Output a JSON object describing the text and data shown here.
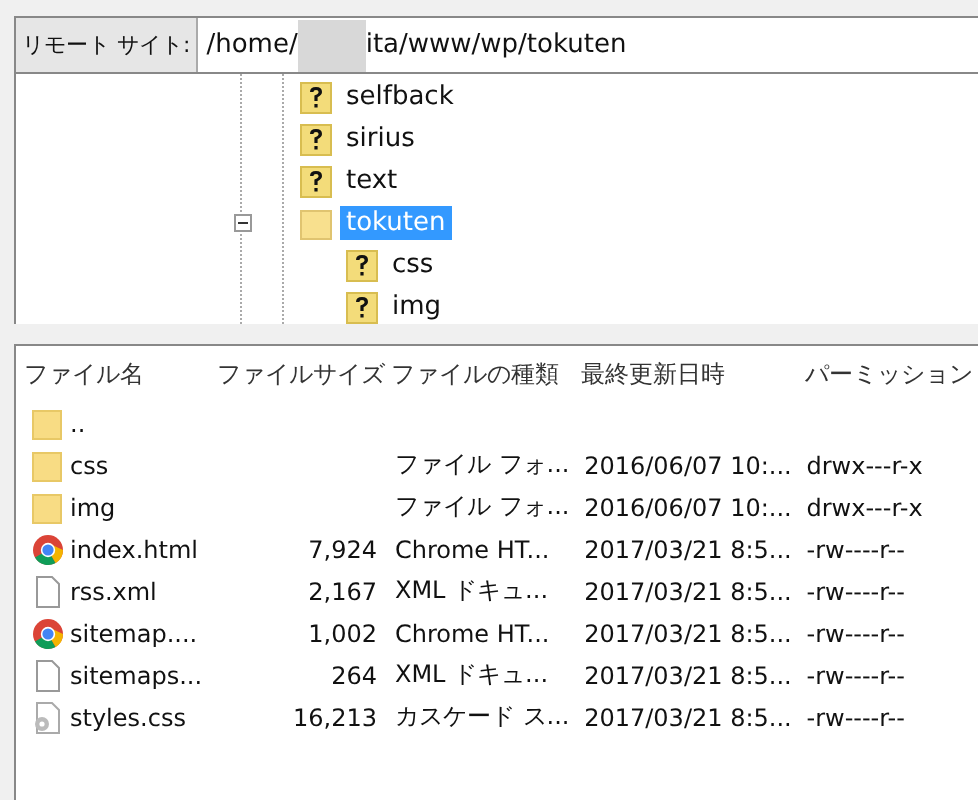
{
  "remote_site": {
    "label": "リモート サイト:",
    "path_start": "/home/",
    "path_end": "ita/www/wp/tokuten"
  },
  "tree": [
    {
      "name": "selfback",
      "kind": "unknown",
      "selected": false
    },
    {
      "name": "sirius",
      "kind": "unknown",
      "selected": false
    },
    {
      "name": "text",
      "kind": "unknown",
      "selected": false
    },
    {
      "name": "tokuten",
      "kind": "folder",
      "selected": true,
      "expanded": true,
      "children": [
        {
          "name": "css",
          "kind": "unknown",
          "selected": false
        },
        {
          "name": "img",
          "kind": "unknown",
          "selected": false
        }
      ]
    }
  ],
  "file_list": {
    "columns": [
      "ファイル名",
      "ファイルサイズ",
      "ファイルの種類",
      "最終更新日時",
      "パーミッション"
    ],
    "rows": [
      {
        "kind": "folder",
        "name": "..",
        "size": "",
        "type": "",
        "modified": "",
        "permissions": ""
      },
      {
        "kind": "folder",
        "name": "css",
        "type": "ファイル フォ...",
        "modified": "2016/06/07 10:...",
        "permissions": "drwx---r-x"
      },
      {
        "kind": "folder",
        "name": "img",
        "type": "ファイル フォ...",
        "modified": "2016/06/07 10:...",
        "permissions": "drwx---r-x"
      },
      {
        "kind": "chrome",
        "name": "index.html",
        "size": "7,924",
        "type": "Chrome HT...",
        "modified": "2017/03/21 8:5...",
        "permissions": "-rw----r--"
      },
      {
        "kind": "file",
        "name": "rss.xml",
        "size": "2,167",
        "type": "XML ドキュ...",
        "modified": "2017/03/21 8:5...",
        "permissions": "-rw----r--"
      },
      {
        "kind": "chrome",
        "name": "sitemap....",
        "size": "1,002",
        "type": "Chrome HT...",
        "modified": "2017/03/21 8:5...",
        "permissions": "-rw----r--"
      },
      {
        "kind": "file",
        "name": "sitemaps...",
        "size": "264",
        "type": "XML ドキュ...",
        "modified": "2017/03/21 8:5...",
        "permissions": "-rw----r--"
      },
      {
        "kind": "gear",
        "name": "styles.css",
        "size": "16,213",
        "type": "カスケード ス...",
        "modified": "2017/03/21 8:5...",
        "permissions": "-rw----r--"
      }
    ]
  }
}
